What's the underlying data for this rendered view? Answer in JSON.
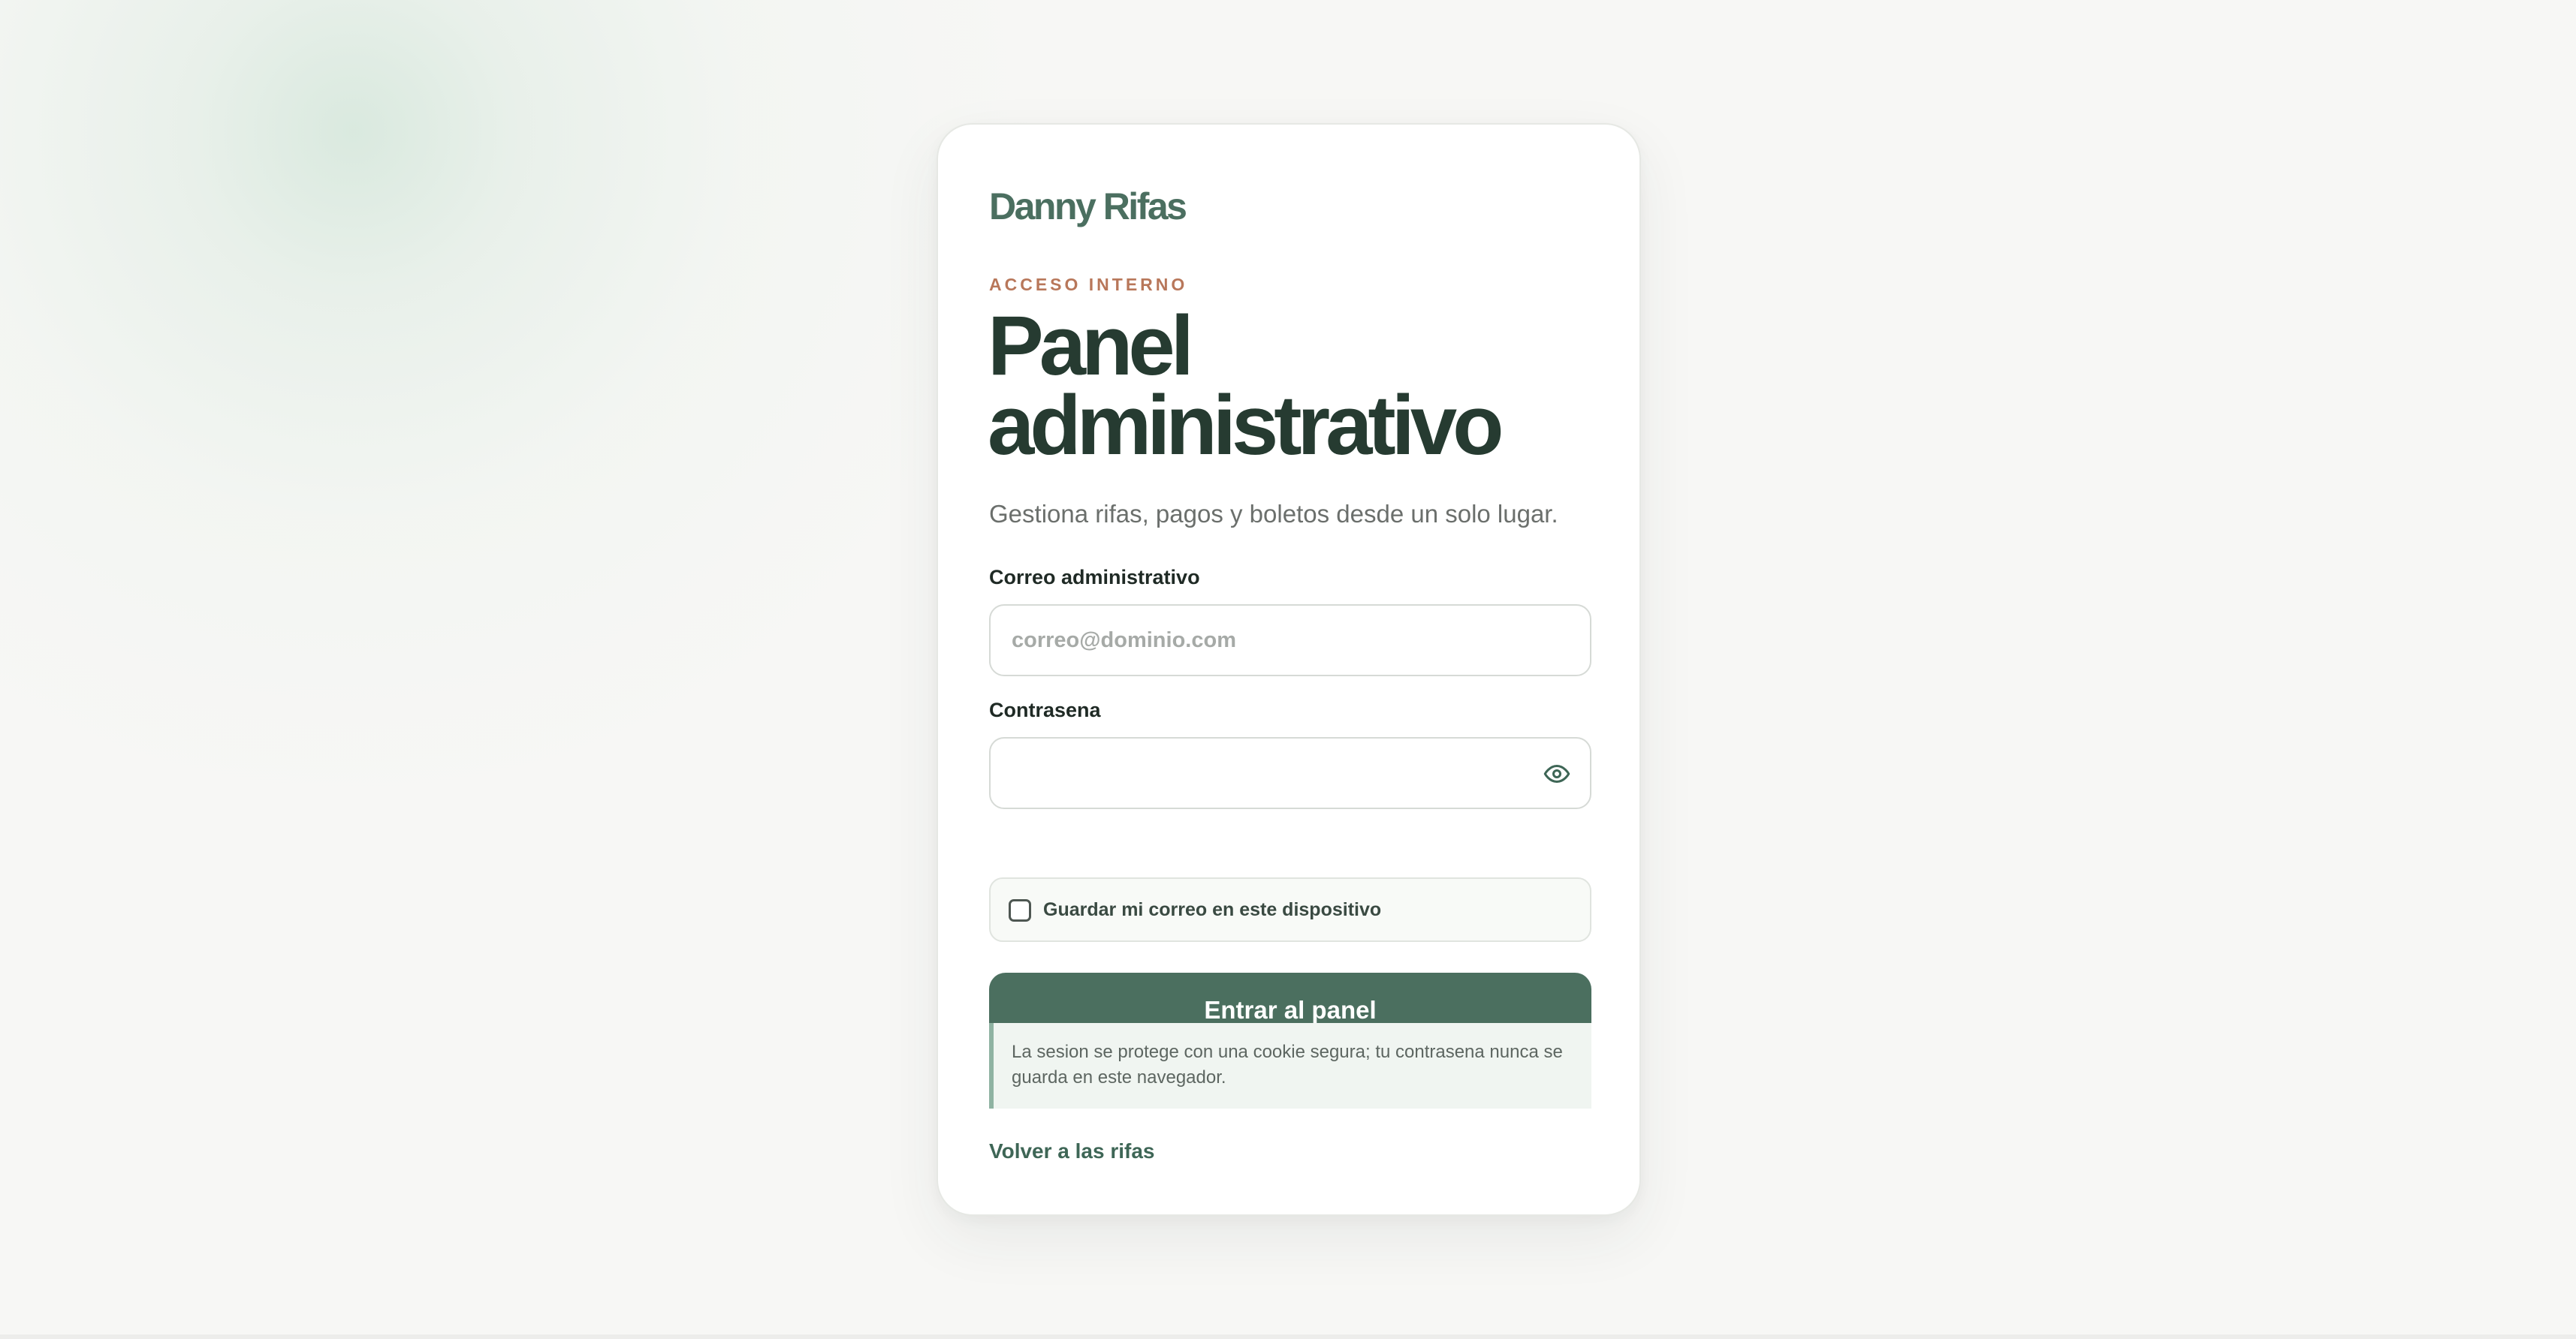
{
  "brand": "Danny Rifas",
  "eyebrow": "ACCESO INTERNO",
  "title": "Panel administrativo",
  "subtitle": "Gestiona rifas, pagos y boletos desde un solo lugar.",
  "form": {
    "email_label": "Correo administrativo",
    "email_value": "",
    "email_placeholder": "correo@dominio.com",
    "password_label": "Contrasena",
    "password_value": "",
    "remember_label": "Guardar mi correo en este dispositivo",
    "remember_checked": false,
    "submit_label": "Entrar al panel"
  },
  "notice": "La sesion se protege con una cookie segura; tu contrasena nunca se guarda en este navegador.",
  "back_link": "Volver a las rifas",
  "icons": {
    "password_toggle": "eye-icon"
  },
  "colors": {
    "brand": "#4b6f60",
    "accent_button": "#4b6f5f",
    "eyebrow": "#b8775a",
    "title": "#263b31",
    "background": "#f7f7f5"
  }
}
